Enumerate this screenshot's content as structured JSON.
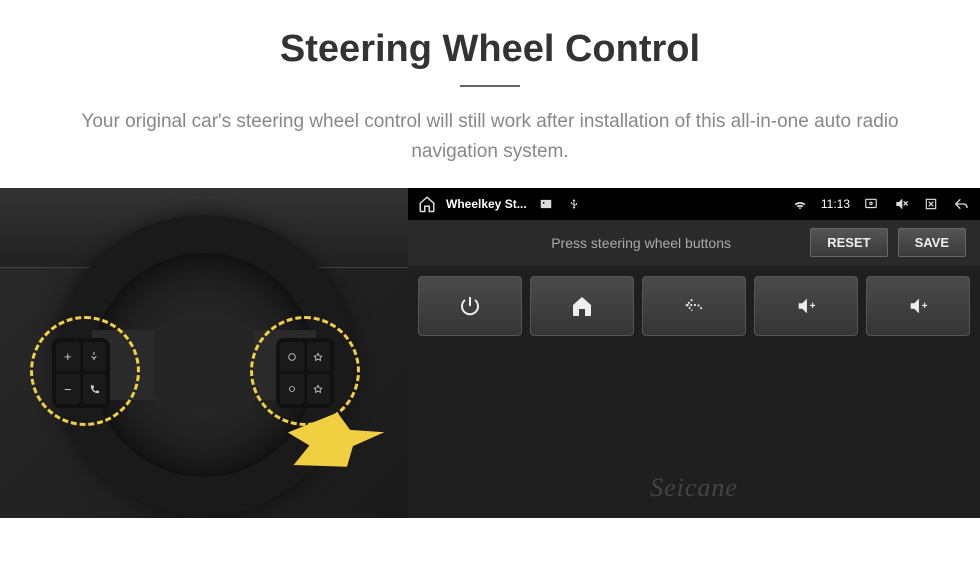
{
  "header": {
    "title": "Steering Wheel Control",
    "subtitle": "Your original car's steering wheel control will still work after installation of this all-in-one auto radio navigation system."
  },
  "wheel": {
    "pad_left": {
      "btn1": "+",
      "btn2": "voice",
      "btn3": "−",
      "btn4": "phone"
    },
    "pad_right": {
      "btn1": "c1",
      "btn2": "c2",
      "btn3": "c3",
      "btn4": "c4"
    }
  },
  "statusbar": {
    "app_title": "Wheelkey St...",
    "time": "11:13",
    "icons": {
      "home": "home",
      "image": "image",
      "usb": "usb",
      "wifi": "wifi",
      "cast": "cast",
      "mute": "mute",
      "close": "close",
      "back": "back"
    }
  },
  "instruction": {
    "text": "Press steering wheel buttons",
    "reset_label": "RESET",
    "save_label": "SAVE"
  },
  "controls": {
    "btn1": "power",
    "btn2": "home",
    "btn3": "back",
    "btn4": "vol-up",
    "btn5": "vol-up"
  },
  "watermark": "Seicane"
}
